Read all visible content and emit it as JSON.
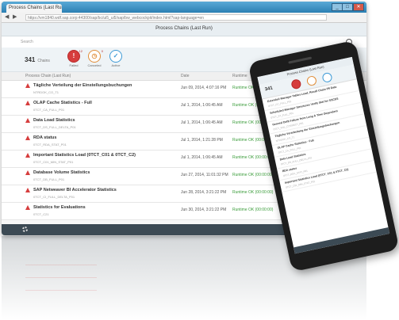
{
  "browser": {
    "tab_title": "Process Chains (Last Run)",
    "url": "https://vm1840.wdf.sap.corp:44300/sap/bc/ui5_ui5/sap/bw_webcockpit/index.html?sap-language=en",
    "win_min": "_",
    "win_max": "□",
    "win_close": "✕",
    "nav_back": "◀",
    "nav_forward": "▶"
  },
  "app": {
    "title": "Process Chains (Last Run)",
    "search_placeholder": "Search",
    "total_count": "341",
    "total_label": "Chains",
    "statuses": [
      {
        "label": "Failed",
        "glyph": "!",
        "badge": "12"
      },
      {
        "label": "Canceled",
        "glyph": "◷",
        "badge": "0"
      },
      {
        "label": "Active",
        "glyph": "✓",
        "badge": ""
      }
    ],
    "columns": {
      "name": "Process Chain (Last Run)",
      "date": "Date",
      "status": "Runtime"
    },
    "rows": [
      {
        "name": "Tägliche Verteilung der Einstellungsbuchungen",
        "sub": "NTRDOK_CO_T1",
        "date": "Jun 09, 2014, 4:07:16 PM",
        "status": "Runtime OK (00:00:00)"
      },
      {
        "name": "OLAP Cache Statistics - Full",
        "sub": "0TCT_CA_FULL_P01",
        "date": "Jul 1, 2014, 1:06:45 AM",
        "status": "Runtime OK (00:00:00)"
      },
      {
        "name": "Data Load Statistics",
        "sub": "0TCT_DS_FULL_DELTA_P01",
        "date": "Jul 1, 2014, 1:06:45 AM",
        "status": "Runtime OK (00:00:00)"
      },
      {
        "name": "RDA status",
        "sub": "0TCT_RDA_STAT_P01",
        "date": "Jul 1, 2014, 1:21:28 PM",
        "status": "Runtime OK (00:00:00)"
      },
      {
        "name": "Important Statistics Load (0TCT_C01 & 0TCT_C2)",
        "sub": "0TCT_C01_MIN_STAT_P01",
        "date": "Jul 1, 2014, 1:06:45 AM",
        "status": "Runtime OK (00:00:00)"
      },
      {
        "name": "Database Volume Statistics",
        "sub": "0TCT_DB_FULL_P01",
        "date": "Jun 27, 2014, 11:01:32 PM",
        "status": "Runtime OK (00:00:00)"
      },
      {
        "name": "SAP Netweaver BI Accelerator Statistics",
        "sub": "0TCT_CI_FULL_DELTA_P01",
        "date": "Jun 28, 2014, 3:21:22 PM",
        "status": "Runtime OK (00:00:00)"
      },
      {
        "name": "Statistics for Evaluations",
        "sub": "0TCT_C21",
        "date": "Jun 30, 2014, 3:21:22 PM",
        "status": "Runtime OK (00:00:00)"
      }
    ]
  },
  "phone": {
    "title": "Process Chains (Last Run)",
    "count": "341",
    "rows": [
      {
        "name": "Extended Manager Tables Load, Recall Chain P8 Data",
        "sub": "0TCT_CC_FULL_P01"
      },
      {
        "name": "Scheduled Manager Structures Verify Stat for SSCES",
        "sub": "0TCT_ST_FULL_P01"
      },
      {
        "name": "General Deflt Failure from Long & Time Dependent",
        "sub": "0TCT_FAIL_CORRECT_P01"
      },
      {
        "name": "Tägliche Verarbeitung der Einstellungsbuchungen",
        "sub": "NTRDOK_CO_T1"
      },
      {
        "name": "OLAP Cache Statistics - Full",
        "sub": "0TCT_CA_FULL_P01"
      },
      {
        "name": "Data Load Statistics",
        "sub": "0TCT_DS_FULL_DELTA_P01"
      },
      {
        "name": "RDA status",
        "sub": "0TCT_RDA_STAT_P01"
      },
      {
        "name": "Important Statistics Load (0TCT_C01 & 0TCT_C2)",
        "sub": "0TCT_C01_MIN_STAT_P01"
      }
    ]
  }
}
